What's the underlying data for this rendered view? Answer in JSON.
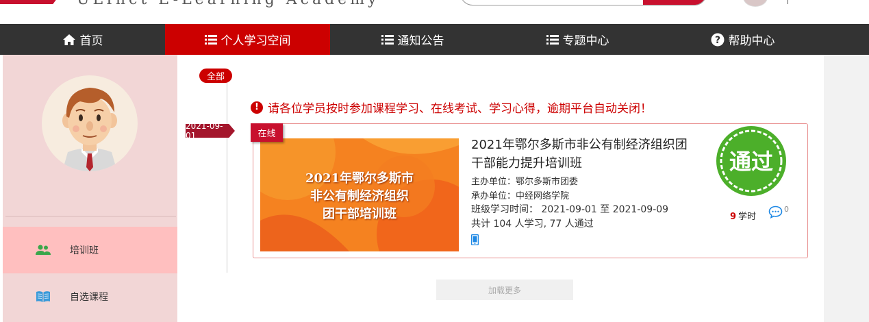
{
  "header": {
    "brand_text": "ULInct E-Learning Academy"
  },
  "nav": {
    "items": [
      {
        "label": "首页",
        "icon": "home-icon"
      },
      {
        "label": "个人学习空间",
        "icon": "list-icon"
      },
      {
        "label": "通知公告",
        "icon": "list-icon"
      },
      {
        "label": "专题中心",
        "icon": "list-icon"
      },
      {
        "label": "帮助中心",
        "icon": "question-icon"
      }
    ],
    "active_index": 1
  },
  "sidebar": {
    "items": [
      {
        "label": "培训班",
        "icon": "users-icon"
      },
      {
        "label": "自选课程",
        "icon": "book-icon"
      }
    ],
    "active_index": 0
  },
  "main": {
    "filter_badge": "全部",
    "notice": "请各位学员按时参加课程学习、在线考试、学习心得，逾期平台自动关闭！",
    "course": {
      "date": "2021-09-01",
      "mode_tag": "在线",
      "cover_lines": [
        "2021年鄂尔多斯市",
        "非公有制经济组织",
        "团干部培训班"
      ],
      "title": "2021年鄂尔多斯市非公有制经济组织团干部能力提升培训班",
      "organizer": "主办单位：鄂尔多斯市团委",
      "undertaker": "承办单位：中经网络学院",
      "period": "班级学习时间： 2021-09-01 至 2021-09-09",
      "stats": "共计 104 人学习, 77 人通过",
      "status_stamp": "通过",
      "hours_value": "9",
      "hours_unit": "学时",
      "comment_count": "0"
    },
    "load_more": "加载更多"
  },
  "colors": {
    "brand_red": "#cc0000",
    "nav_bg": "#333333",
    "sidebar_bg": "#f2d6d6",
    "sidebar_active": "#ffbfbf",
    "stamp_green": "#4caf2a"
  }
}
